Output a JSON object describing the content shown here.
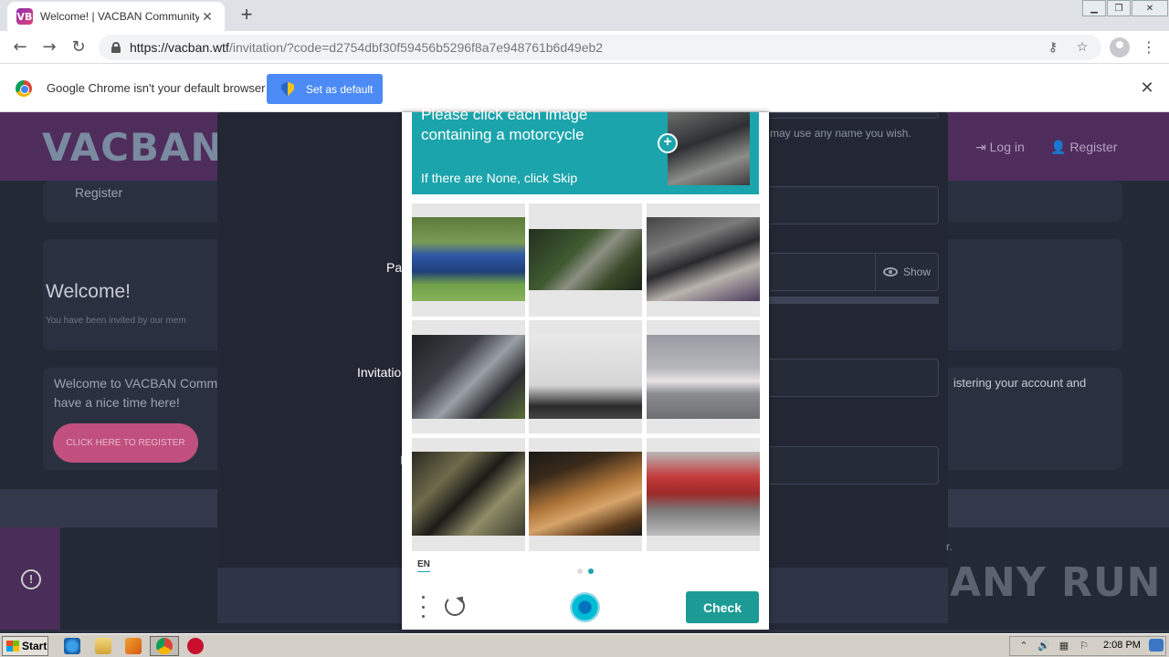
{
  "browser": {
    "tab_title": "Welcome! | VACBAN Community",
    "tab_favicon_text": "VB",
    "url_scheme_host": "https://vacban.wtf",
    "url_path": "/invitation/?code=d2754dbf30f59456b5296f8a7e948761b6d49eb2",
    "infobar_text": "Google Chrome isn't your default browser",
    "set_default_label": "Set as default"
  },
  "site": {
    "logo": "VACBAN",
    "nav_login": "Log in",
    "nav_register": "Register",
    "panel_register": "Register",
    "welcome_title": "Welcome!",
    "welcome_sub": "You have been invited by our mem",
    "welcome_box_line1": "Welcome to VACBAN Comm",
    "welcome_box_line2": "have a nice time here!",
    "register_button": "CLICK HERE TO REGISTER",
    "name_hint": "u may use any name you wish.",
    "password_label": "Pa",
    "show_label": "Show",
    "invitation_label": "Invitatio",
    "account_hint": "istering your account and",
    "footer_hint": "r.",
    "watermark": "ANY RUN"
  },
  "captcha": {
    "prompt_title": "Please click each image containing a motorcycle",
    "prompt_sub": "If there are None, click Skip",
    "language": "EN",
    "check_label": "Check",
    "tiles": [
      {
        "name": "blue-pickup-truck"
      },
      {
        "name": "railway-track"
      },
      {
        "name": "bicycles-and-crowd"
      },
      {
        "name": "motorcycle-rear-closeup"
      },
      {
        "name": "white-van-side"
      },
      {
        "name": "jet-airliner"
      },
      {
        "name": "engine-bay"
      },
      {
        "name": "gold-car-hood"
      },
      {
        "name": "red-train"
      }
    ]
  },
  "taskbar": {
    "start_label": "Start",
    "clock": "2:08 PM"
  },
  "colors": {
    "captcha_teal": "#1ba4ab",
    "check_button": "#1c9a95",
    "set_default_blue": "#4c8bf5"
  }
}
